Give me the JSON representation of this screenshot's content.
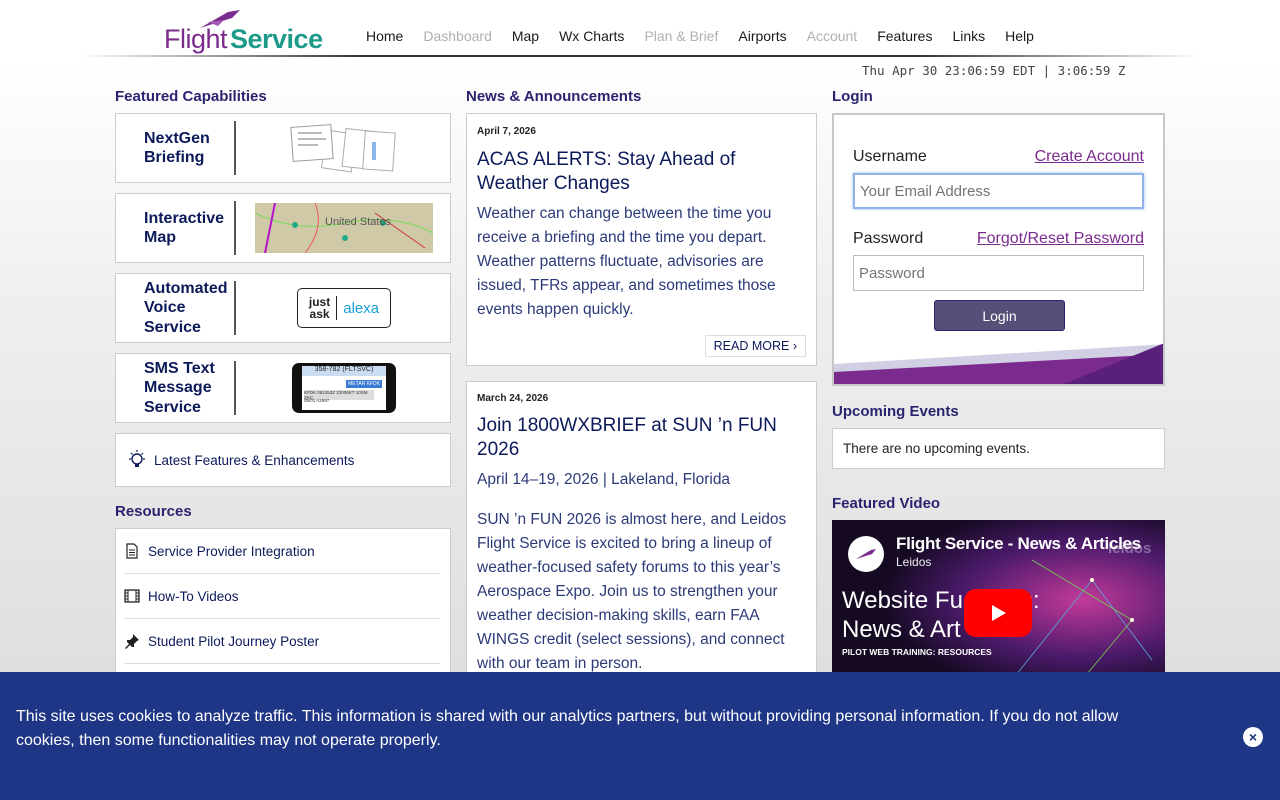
{
  "logo": {
    "part1": "Flight",
    "part2": "Service"
  },
  "nav": [
    {
      "label": "Home",
      "disabled": false
    },
    {
      "label": "Dashboard",
      "disabled": true
    },
    {
      "label": "Map",
      "disabled": false
    },
    {
      "label": "Wx Charts",
      "disabled": false
    },
    {
      "label": "Plan & Brief",
      "disabled": true
    },
    {
      "label": "Airports",
      "disabled": false
    },
    {
      "label": "Account",
      "disabled": true
    },
    {
      "label": "Features",
      "disabled": false
    },
    {
      "label": "Links",
      "disabled": false
    },
    {
      "label": "Help",
      "disabled": false
    }
  ],
  "clock": "Thu Apr 30 23:06:59 EDT | 3:06:59 Z",
  "featured": {
    "title": "Featured Capabilities",
    "items": [
      {
        "label": "NextGen Briefing"
      },
      {
        "label": "Interactive Map",
        "map_text": "United States"
      },
      {
        "label": "Automated Voice Service",
        "just": "just",
        "ask": "ask",
        "alexa": "alexa"
      },
      {
        "label": "SMS Text Message Service",
        "phone_num": "358-782 (FLTSVC)",
        "phone_tag": "METAR KFDK",
        "phone_l1": "KFDK 061353Z 22006KT 10SM SKC",
        "phone_l2": "05/01 A2997"
      }
    ],
    "latest": "Latest Features & Enhancements"
  },
  "resources": {
    "title": "Resources",
    "items": [
      "Service Provider Integration",
      "How-To Videos",
      "Student Pilot Journey Poster"
    ]
  },
  "news": {
    "title": "News & Announcements",
    "items": [
      {
        "date": "April 7, 2026",
        "headline": "ACAS ALERTS: Stay Ahead of Weather Changes",
        "body": "Weather can change between the time you receive a briefing and the time you depart. Weather patterns fluctuate, advisories are issued, TFRs appear, and sometimes those events happen quickly.",
        "read_more": "READ MORE"
      },
      {
        "date": "March 24, 2026",
        "headline": "Join 1800WXBRIEF at SUN ’n FUN 2026",
        "sub": "April 14–19, 2026 | Lakeland, Florida",
        "body": "SUN ’n FUN 2026 is almost here, and Leidos Flight Service is excited to bring a lineup of weather-focused safety forums to this year’s Aerospace Expo. Join us to strengthen your weather decision-making skills, earn FAA WINGS credit (select sessions), and connect with our team in person."
      }
    ]
  },
  "login": {
    "title": "Login",
    "username_label": "Username",
    "create_account": "Create Account",
    "username_placeholder": "Your Email Address",
    "password_label": "Password",
    "forgot": "Forgot/Reset Password",
    "password_placeholder": "Password",
    "button": "Login"
  },
  "events": {
    "title": "Upcoming Events",
    "empty": "There are no upcoming events."
  },
  "video": {
    "title": "Featured Video",
    "video_title": "Flight Service - News & Articles",
    "channel": "Leidos",
    "watermark": "leidos",
    "line1": "Website Fu",
    "line1b": "s:",
    "line2": "News & Art",
    "caption": "PILOT WEB TRAINING: RESOURCES"
  },
  "cookie": {
    "message": "This site uses cookies to analyze traffic. This information is shared with our analytics partners, but without providing personal information. If you do not allow cookies, then some functionalities may not operate properly.",
    "close": "×"
  }
}
